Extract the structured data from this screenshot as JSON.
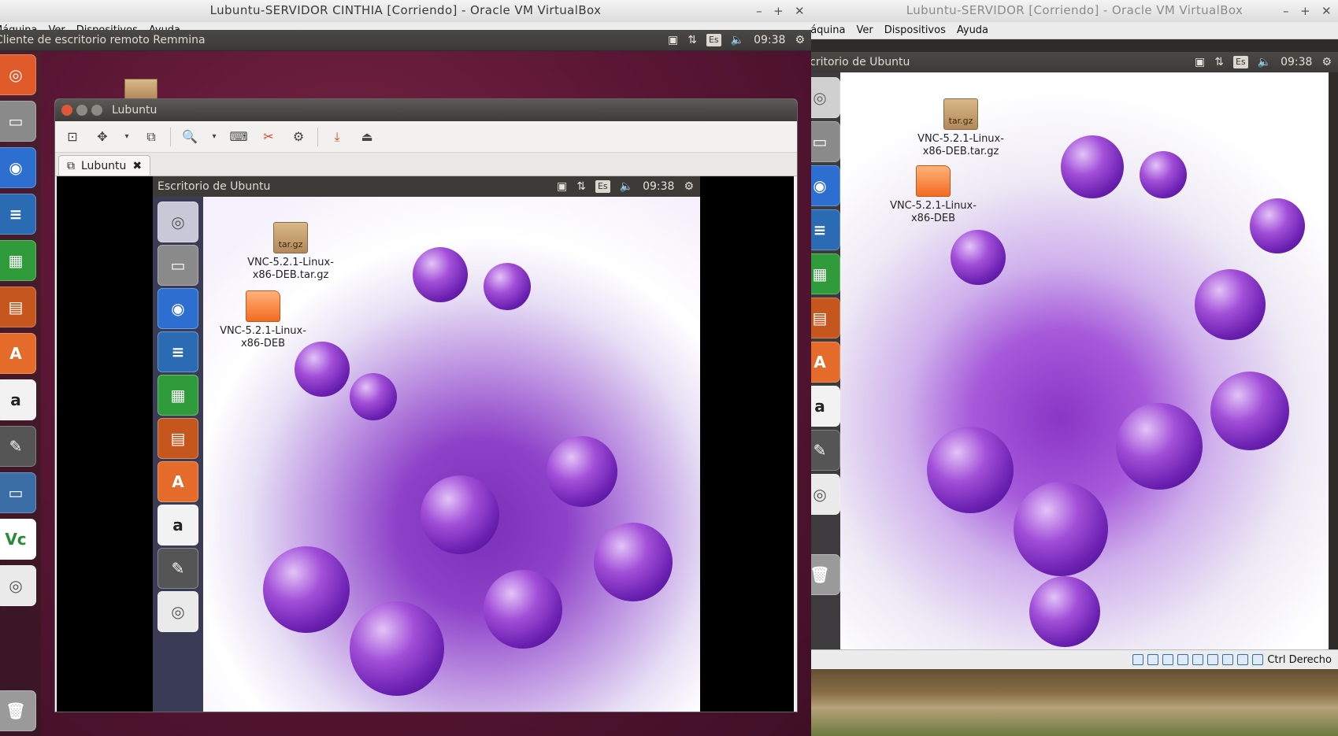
{
  "left_vm": {
    "title": "Lubuntu-SERVIDOR CINTHIA [Corriendo] - Oracle VM VirtualBox",
    "menu": [
      "Máquina",
      "Ver",
      "Dispositivos",
      "Ayuda"
    ],
    "panel_title": "Cliente de escritorio remoto Remmina",
    "indicators": {
      "lang": "Es",
      "time": "09:38"
    }
  },
  "remmina": {
    "title": "Lubuntu",
    "tab_label": "Lubuntu",
    "remote": {
      "panel_title": "Escritorio de Ubuntu",
      "indicators": {
        "lang": "Es",
        "time": "09:38"
      },
      "icons": [
        {
          "label_line1": "VNC-5.2.1-Linux-",
          "label_line2": "x86-DEB.tar.gz",
          "badge": "tar.gz"
        },
        {
          "label_line1": "VNC-5.2.1-Linux-",
          "label_line2": "x86-DEB"
        }
      ]
    }
  },
  "right_vm": {
    "title": "Lubuntu-SERVIDOR [Corriendo] - Oracle VM VirtualBox",
    "menu": [
      "Máquina",
      "Ver",
      "Dispositivos",
      "Ayuda"
    ],
    "panel_title": "Escritorio de Ubuntu",
    "indicators": {
      "lang": "Es",
      "time": "09:38"
    },
    "icons": [
      {
        "label_line1": "VNC-5.2.1-Linux-",
        "label_line2": "x86-DEB.tar.gz",
        "badge": "tar.gz"
      },
      {
        "label_line1": "VNC-5.2.1-Linux-",
        "label_line2": "x86-DEB"
      }
    ],
    "host_key": "Ctrl Derecho"
  },
  "launcher_icons": [
    "ubuntu-icon",
    "files-icon",
    "firefox-icon",
    "writer-icon",
    "calc-icon",
    "impress-icon",
    "software-center-icon",
    "amazon-icon",
    "settings-icon",
    "remmina-icon",
    "vnc-icon",
    "dvd-icon",
    "trash-icon"
  ],
  "colors": {
    "accent": "#dd4814",
    "panel": "#3c3b37",
    "aubergine": "#5a1634"
  }
}
